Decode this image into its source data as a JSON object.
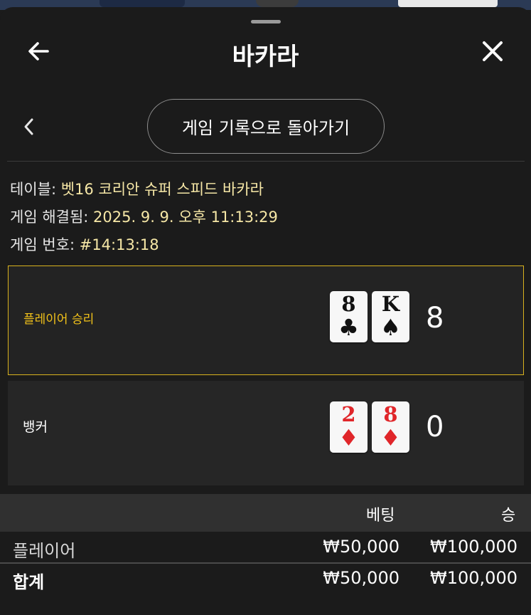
{
  "header": {
    "title": "바카라",
    "back_icon": "arrow-left-icon",
    "close_icon": "close-icon"
  },
  "nav": {
    "history_button_label": "게임 기록으로 돌아가기",
    "prev_icon": "chevron-left-icon"
  },
  "info": {
    "table_label": "테이블:",
    "table_value": "벳16 코리안 슈퍼 스피드 바카라",
    "resolved_label": "게임 해결됨:",
    "resolved_value": "2025. 9. 9. 오후 11:13:29",
    "game_no_label": "게임 번호:",
    "game_no_value": "#14:13:18"
  },
  "result": {
    "player": {
      "label": "플레이어 승리",
      "cards": [
        {
          "rank": "8",
          "suit": "♣",
          "color": "black"
        },
        {
          "rank": "K",
          "suit": "♠",
          "color": "black"
        }
      ],
      "score": "8"
    },
    "banker": {
      "label": "뱅커",
      "cards": [
        {
          "rank": "2",
          "suit": "♦",
          "color": "red"
        },
        {
          "rank": "8",
          "suit": "♦",
          "color": "red"
        }
      ],
      "score": "0"
    }
  },
  "bets": {
    "headers": {
      "bet": "베팅",
      "win": "승"
    },
    "rows": [
      {
        "name": "플레이어",
        "bet": "₩50,000",
        "win": "₩100,000"
      }
    ],
    "total": {
      "name": "합계",
      "bet": "₩50,000",
      "win": "₩100,000"
    }
  },
  "colors": {
    "accent": "#d8b21e",
    "winner_text": "#f2c21a",
    "info_value": "#f6e7a6",
    "red_suit": "#e0262a"
  }
}
